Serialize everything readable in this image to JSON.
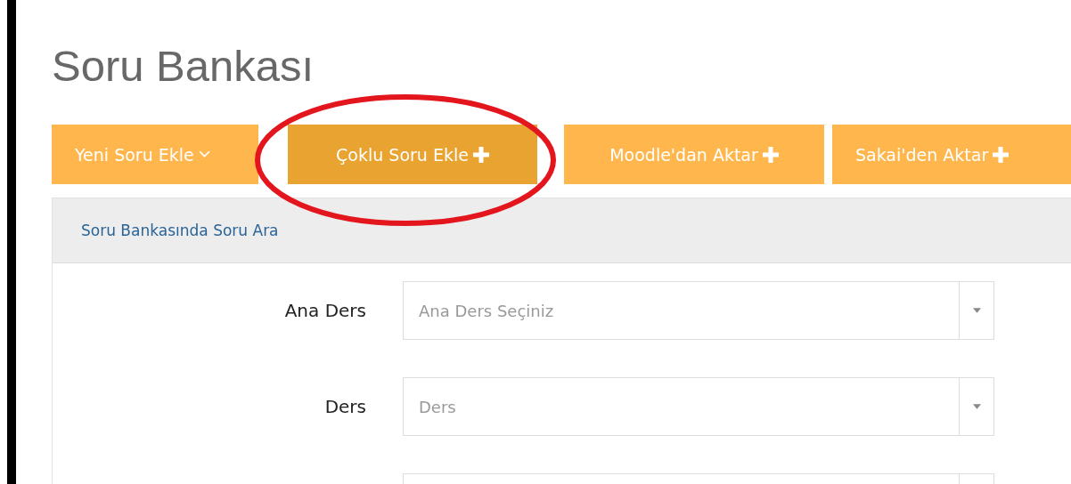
{
  "page_title": "Soru Bankası",
  "actions": [
    {
      "label": "Yeni Soru Ekle",
      "kind": "dropdown",
      "active": false,
      "highlighted": false
    },
    {
      "label": "Çoklu Soru Ekle",
      "kind": "add",
      "active": true,
      "highlighted": true
    },
    {
      "label": "Moodle'dan Aktar",
      "kind": "add",
      "active": false,
      "highlighted": false
    },
    {
      "label": "Sakai'den Aktar",
      "kind": "add",
      "active": false,
      "highlighted": false
    }
  ],
  "search_panel": {
    "title": "Soru Bankasında Soru Ara",
    "fields": [
      {
        "kind": "select",
        "label": "Ana Ders",
        "placeholder": "Ana Ders Seçiniz"
      },
      {
        "kind": "select",
        "label": "Ders",
        "placeholder": "Ders"
      },
      {
        "kind": "select"
      }
    ]
  }
}
